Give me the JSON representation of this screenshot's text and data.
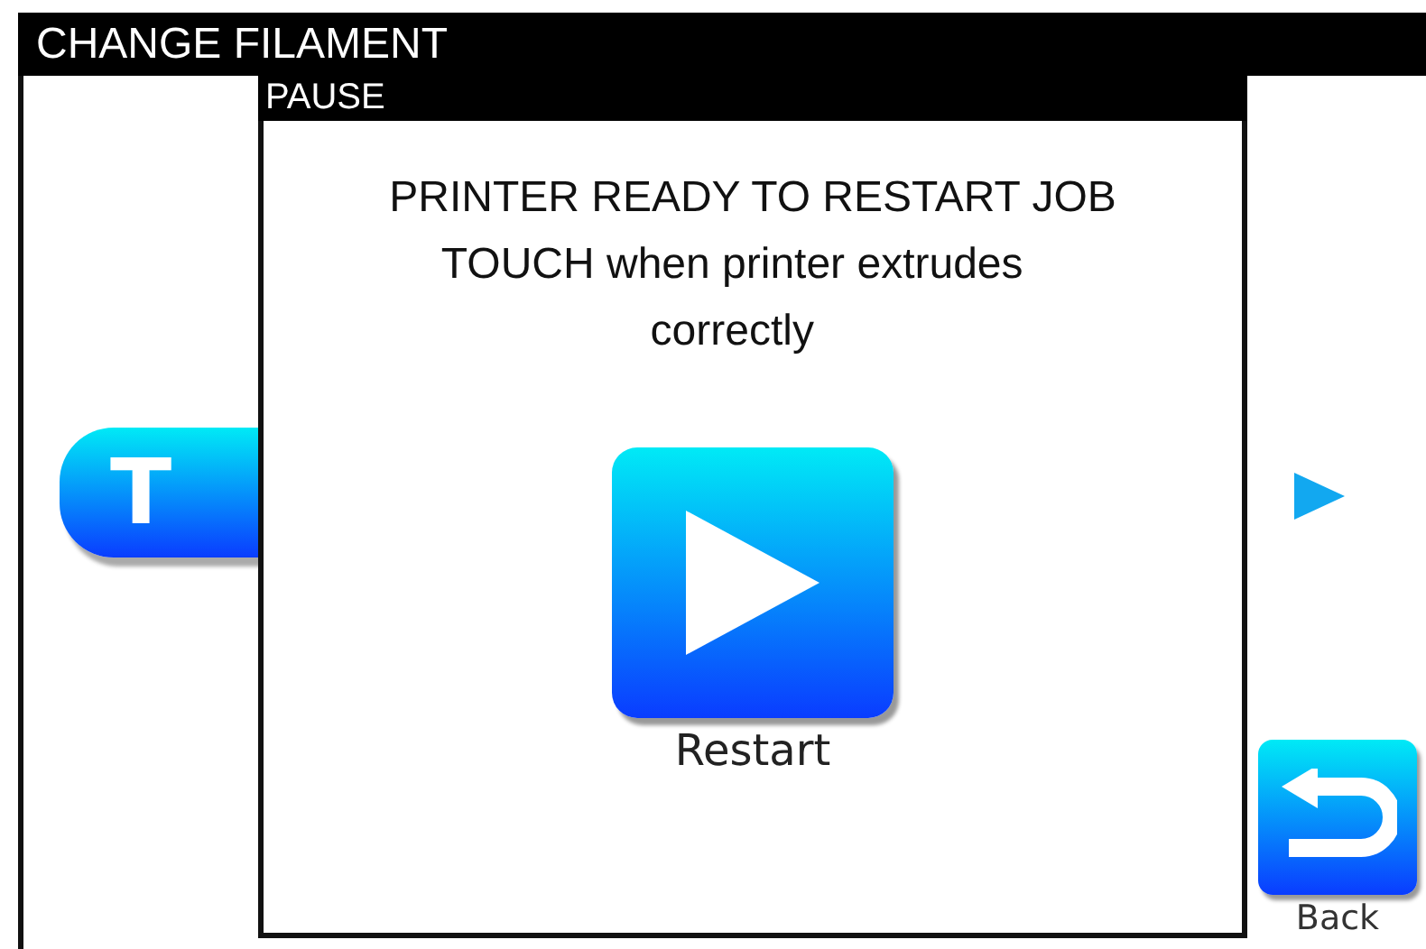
{
  "screen": {
    "title": "CHANGE FILAMENT",
    "tool_button": {
      "label": "T"
    },
    "back_button": {
      "label": "Back"
    }
  },
  "dialog": {
    "title": "PAUSE",
    "message": [
      "PRINTER READY TO RESTART JOB",
      "TOUCH when printer extrudes correctly"
    ],
    "action": {
      "label": "Restart"
    }
  }
}
